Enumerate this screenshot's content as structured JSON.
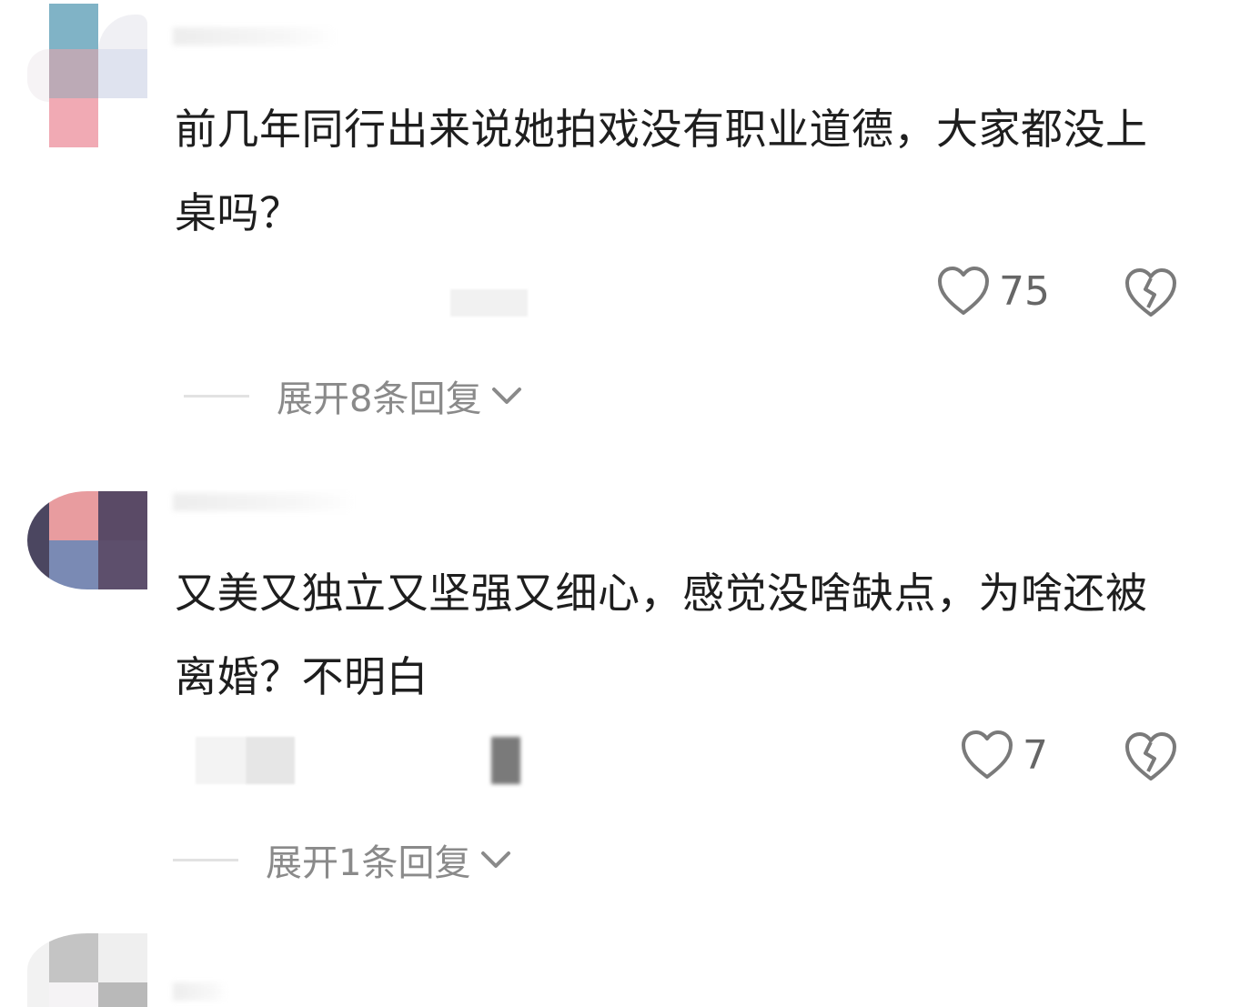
{
  "comments": [
    {
      "text": "前几年同行出来说她拍戏没有职业道德，大家都没上桌吗？",
      "likes": "75",
      "expand_label": "展开8条回复",
      "avatar_icon": "blurred-avatar"
    },
    {
      "text": "又美又独立又坚强又细心，感觉没啥缺点，为啥还被离婚？不明白",
      "likes": "7",
      "expand_label": "展开1条回复",
      "avatar_icon": "blurred-avatar"
    },
    {
      "text": "",
      "avatar_icon": "blurred-avatar"
    }
  ],
  "icons": {
    "like": "heart-outline-icon",
    "dislike": "broken-heart-icon",
    "expand": "chevron-down-icon"
  },
  "colors": {
    "text": "#1e1e1e",
    "muted": "#8a8a8a",
    "icon": "#7a7a7a"
  }
}
